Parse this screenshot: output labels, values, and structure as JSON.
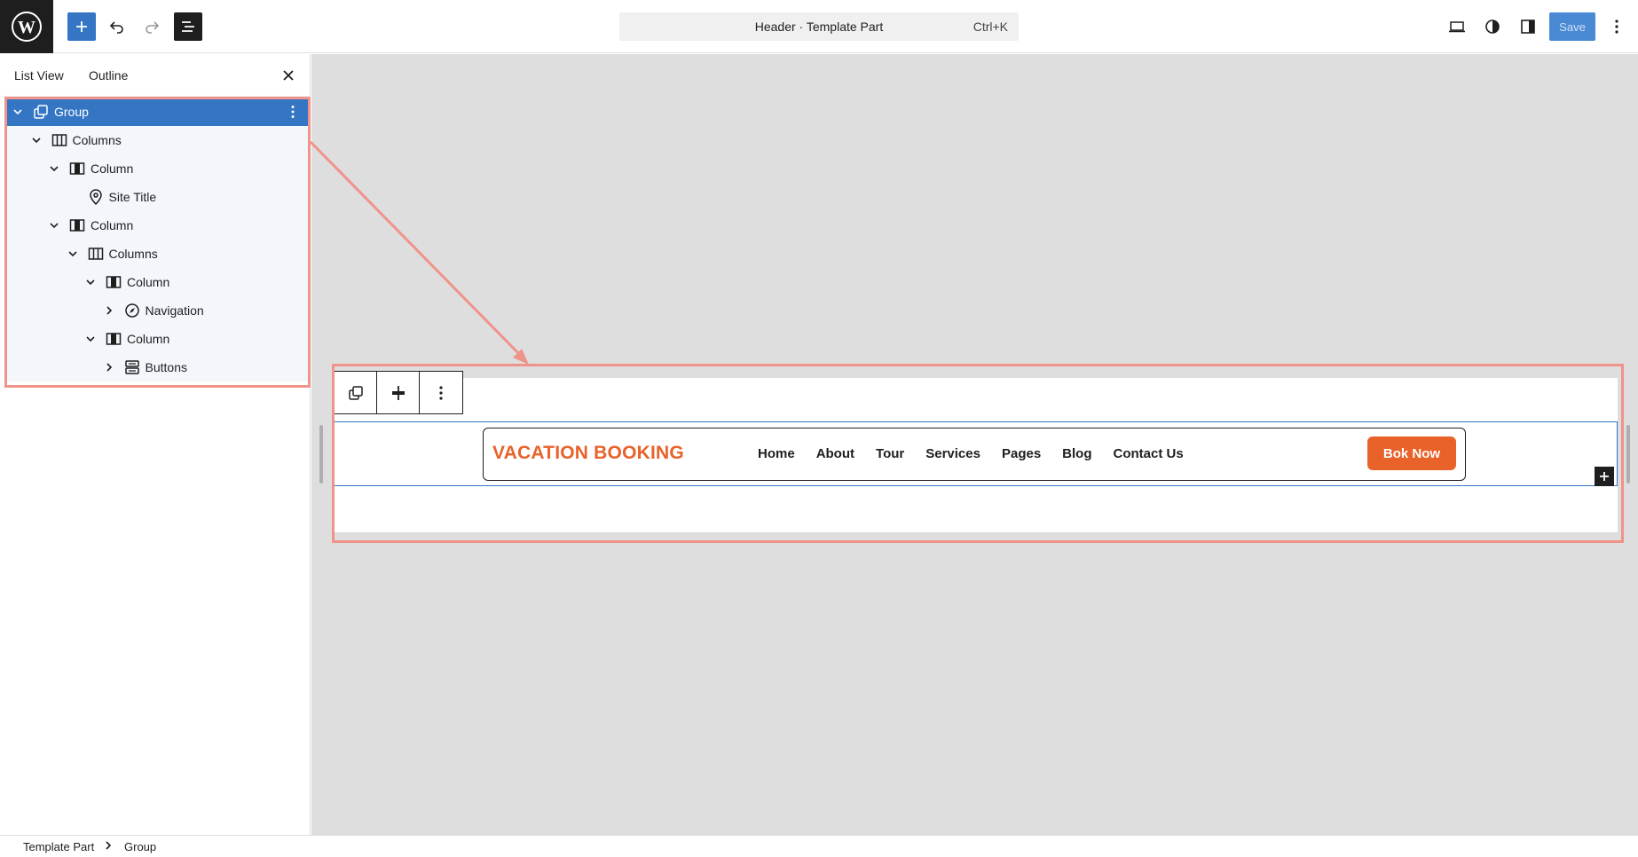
{
  "topbar": {
    "document_title": "Header · Template Part",
    "shortcut": "Ctrl+K",
    "save_label": "Save",
    "icons": [
      "wordpress-logo-icon",
      "plus-icon",
      "undo-icon",
      "redo-icon",
      "list-view-icon",
      "desktop-icon",
      "contrast-icon",
      "sidebar-icon",
      "more-vertical-icon"
    ]
  },
  "sidebar": {
    "tabs": [
      "List View",
      "Outline"
    ],
    "close_icon": "close-icon",
    "tree": [
      {
        "label": "Group",
        "level": 0,
        "expand": "open",
        "icon": "group-icon",
        "selected": true
      },
      {
        "label": "Columns",
        "level": 1,
        "expand": "open",
        "icon": "columns-icon"
      },
      {
        "label": "Column",
        "level": 2,
        "expand": "open",
        "icon": "column-icon"
      },
      {
        "label": "Site Title",
        "level": 3,
        "expand": "none",
        "icon": "map-marker-icon"
      },
      {
        "label": "Column",
        "level": 2,
        "expand": "open",
        "icon": "column-icon"
      },
      {
        "label": "Columns",
        "level": 3,
        "expand": "open",
        "icon": "columns-icon"
      },
      {
        "label": "Column",
        "level": 4,
        "expand": "open",
        "icon": "column-icon"
      },
      {
        "label": "Navigation",
        "level": 5,
        "expand": "closed",
        "icon": "compass-icon"
      },
      {
        "label": "Column",
        "level": 4,
        "expand": "open",
        "icon": "column-icon"
      },
      {
        "label": "Buttons",
        "level": 5,
        "expand": "closed",
        "icon": "buttons-icon"
      }
    ]
  },
  "canvas": {
    "site_title": "VACATION BOOKING",
    "nav": [
      "Home",
      "About",
      "Tour",
      "Services",
      "Pages",
      "Blog",
      "Contact Us"
    ],
    "button": "Bok Now",
    "accent_color": "#e8622a",
    "selection_color": "#3476c4",
    "annotation_color": "#f0938a"
  },
  "breadcrumb": [
    "Template Part",
    "Group"
  ]
}
